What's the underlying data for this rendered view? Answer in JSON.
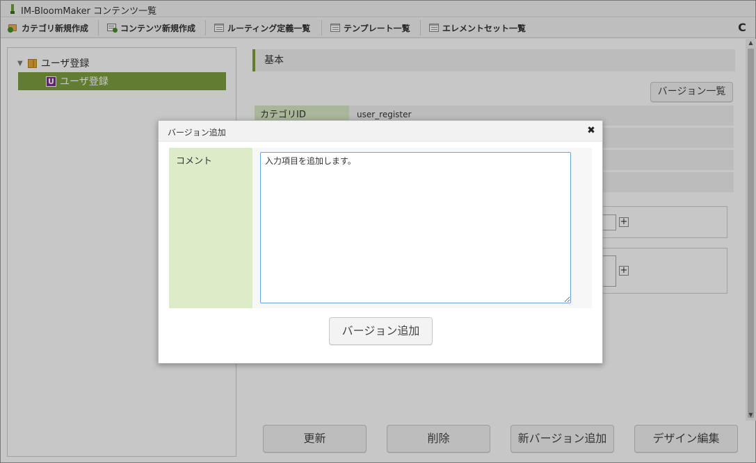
{
  "app": {
    "title": "IM-BloomMaker コンテンツ一覧"
  },
  "toolbar": {
    "items": [
      {
        "label": "カテゴリ新規作成",
        "icon": "folder-add-icon"
      },
      {
        "label": "コンテンツ新規作成",
        "icon": "document-add-icon"
      },
      {
        "label": "ルーティング定義一覧",
        "icon": "list-window-icon"
      },
      {
        "label": "テンプレート一覧",
        "icon": "list-window-icon"
      },
      {
        "label": "エレメントセット一覧",
        "icon": "list-window-icon"
      }
    ],
    "refresh_icon": "C"
  },
  "tree": {
    "toggle_glyph": "▼",
    "category": {
      "label": "ユーザ登録",
      "icon": "folder-icon"
    },
    "content": {
      "badge": "U",
      "label": "ユーザ登録",
      "selected": true
    }
  },
  "detail": {
    "section_title": "基本",
    "version_list_button": "バージョン一覧",
    "properties": [
      {
        "label": "カテゴリID",
        "value": "user_register"
      }
    ],
    "actions": [
      "更新",
      "削除",
      "新バージョン追加",
      "デザイン編集"
    ]
  },
  "dialog": {
    "title": "バージョン追加",
    "close_glyph": "✖",
    "comment_label": "コメント",
    "comment_value": "入力項目を追加します。",
    "submit_label": "バージョン追加"
  },
  "colors": {
    "accent_green": "#7ea03f",
    "label_green": "#d9e9c6",
    "badge_purple": "#7b2f8f",
    "focus_blue": "#66a4e0"
  }
}
